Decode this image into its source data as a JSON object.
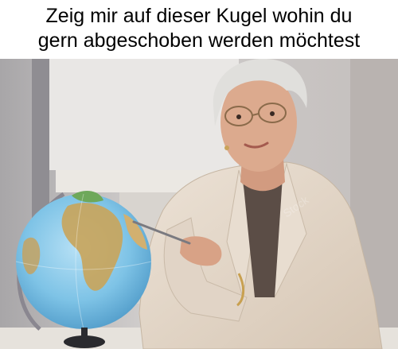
{
  "meme": {
    "caption_line_1": "Zeig mir auf dieser Kugel wohin du",
    "caption_line_2": "gern abgeschoben werden möchtest"
  },
  "photo": {
    "watermark_text": "Stock"
  },
  "colors": {
    "background_wall": "#c9c6c4",
    "window": "#f2f1ef",
    "jacket": "#e3d6c8",
    "skin": "#d9a58a",
    "hair": "#dcdcdc",
    "ocean": "#7ec3e6",
    "land": "#c9a45a",
    "globe_stand": "#2a2a2e"
  }
}
